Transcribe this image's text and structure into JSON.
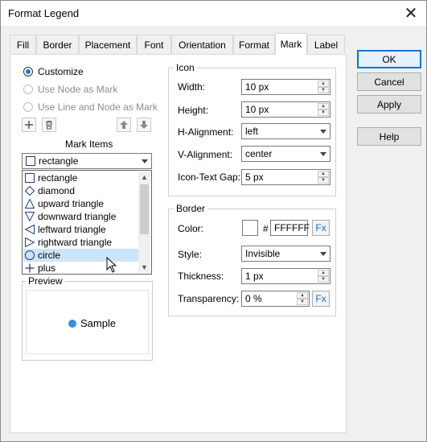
{
  "window": {
    "title": "Format Legend",
    "close_glyph": "✕"
  },
  "tabs": [
    "Fill",
    "Border",
    "Placement",
    "Font",
    "Orientation",
    "Format",
    "Mark",
    "Label"
  ],
  "active_tab": "Mark",
  "mark_source": {
    "customize": "Customize",
    "node_as_mark": "Use Node as Mark",
    "line_and_node": "Use Line and Node as Mark"
  },
  "toolbar": {
    "add_icon": "plus-icon",
    "delete_icon": "trash-icon",
    "up_icon": "arrow-up-icon",
    "down_icon": "arrow-down-icon"
  },
  "mark_items": {
    "label": "Mark Items",
    "selected": "rectangle",
    "options": [
      "rectangle",
      "diamond",
      "upward triangle",
      "downward triangle",
      "leftward triangle",
      "rightward triangle",
      "circle",
      "plus"
    ],
    "highlighted": "circle"
  },
  "preview": {
    "title": "Preview",
    "sample_text": "Sample",
    "mark_color": "#3a8ee6"
  },
  "icon": {
    "title": "Icon",
    "width_label": "Width:",
    "width_value": "10 px",
    "height_label": "Height:",
    "height_value": "10 px",
    "halign_label": "H-Alignment:",
    "halign_value": "left",
    "valign_label": "V-Alignment:",
    "valign_value": "center",
    "gap_label": "Icon-Text Gap:",
    "gap_value": "5 px"
  },
  "border": {
    "title": "Border",
    "color_label": "Color:",
    "hash": "#",
    "color_value": "FFFFFF",
    "fx": "Fx",
    "style_label": "Style:",
    "style_value": "Invisible",
    "thickness_label": "Thickness:",
    "thickness_value": "1 px",
    "transparency_label": "Transparency:",
    "transparency_value": "0 %",
    "fx2": "Fx"
  },
  "buttons": {
    "ok": "OK",
    "cancel": "Cancel",
    "apply": "Apply",
    "help": "Help"
  },
  "colors": {
    "accent": "#0078d7",
    "selection": "#cce4f7"
  }
}
